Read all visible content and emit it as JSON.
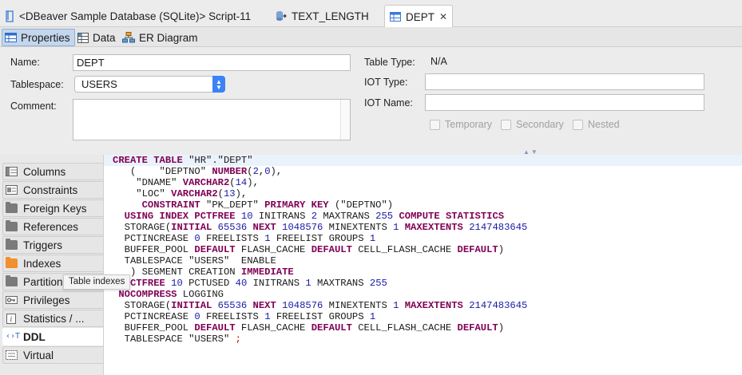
{
  "editor_tabs": [
    {
      "label": "<DBeaver Sample Database (SQLite)> Script-11",
      "icon": "sql-script-icon"
    },
    {
      "label": "TEXT_LENGTH",
      "icon": "procedure-icon"
    },
    {
      "label": "DEPT",
      "icon": "table-icon",
      "close": "✕"
    }
  ],
  "sub_tabs": [
    {
      "label": "Properties",
      "icon": "table-properties-icon"
    },
    {
      "label": "Data",
      "icon": "data-grid-icon"
    },
    {
      "label": "ER Diagram",
      "icon": "er-diagram-icon"
    }
  ],
  "properties": {
    "name_label": "Name:",
    "name_value": "DEPT",
    "tablespace_label": "Tablespace:",
    "tablespace_value": "USERS",
    "comment_label": "Comment:",
    "comment_value": "",
    "table_type_label": "Table Type:",
    "table_type_value": "N/A",
    "iot_type_label": "IOT Type:",
    "iot_type_value": "",
    "iot_name_label": "IOT Name:",
    "iot_name_value": "",
    "checkboxes": [
      "Temporary",
      "Secondary",
      "Nested"
    ]
  },
  "left_tabs": [
    {
      "label": "Columns",
      "icon": "columns-icon"
    },
    {
      "label": "Constraints",
      "icon": "constraints-icon"
    },
    {
      "label": "Foreign Keys",
      "icon": "folder-icon"
    },
    {
      "label": "References",
      "icon": "folder-icon"
    },
    {
      "label": "Triggers",
      "icon": "folder-icon"
    },
    {
      "label": "Indexes",
      "icon": "folder-orange-icon"
    },
    {
      "label": "Partitions",
      "icon": "folder-icon"
    },
    {
      "label": "Privileges",
      "icon": "key-icon"
    },
    {
      "label": "Statistics / ...",
      "icon": "info-icon"
    },
    {
      "label": "DDL",
      "icon": "ddl-icon",
      "active": true
    },
    {
      "label": "Virtual",
      "icon": "virtual-icon"
    }
  ],
  "tooltip": "Table indexes",
  "ddl_lines": [
    [
      [
        "kw",
        "CREATE TABLE "
      ],
      [
        "st",
        "\"HR\".\"DEPT\""
      ]
    ],
    [
      [
        "st",
        "   (    \"DEPTNO\" "
      ],
      [
        "kw",
        "NUMBER"
      ],
      [
        "st",
        "("
      ],
      [
        "nm",
        "2"
      ],
      [
        "st",
        ","
      ],
      [
        "nm",
        "0"
      ],
      [
        "st",
        "),"
      ]
    ],
    [
      [
        "st",
        "    \"DNAME\" "
      ],
      [
        "kw",
        "VARCHAR2"
      ],
      [
        "st",
        "("
      ],
      [
        "nm",
        "14"
      ],
      [
        "st",
        "),"
      ]
    ],
    [
      [
        "st",
        "    \"LOC\" "
      ],
      [
        "kw",
        "VARCHAR2"
      ],
      [
        "st",
        "("
      ],
      [
        "nm",
        "13"
      ],
      [
        "st",
        "),"
      ]
    ],
    [
      [
        "st",
        "     "
      ],
      [
        "kw",
        "CONSTRAINT "
      ],
      [
        "st",
        "\"PK_DEPT\" "
      ],
      [
        "kw",
        "PRIMARY KEY "
      ],
      [
        "st",
        "(\"DEPTNO\")"
      ]
    ],
    [
      [
        "st",
        "  "
      ],
      [
        "kw",
        "USING INDEX PCTFREE "
      ],
      [
        "nm",
        "10"
      ],
      [
        "st",
        " INITRANS "
      ],
      [
        "nm",
        "2"
      ],
      [
        "st",
        " MAXTRANS "
      ],
      [
        "nm",
        "255"
      ],
      [
        "kw",
        " COMPUTE STATISTICS"
      ]
    ],
    [
      [
        "st",
        "  STORAGE("
      ],
      [
        "kw",
        "INITIAL "
      ],
      [
        "nm",
        "65536"
      ],
      [
        "kw",
        " NEXT "
      ],
      [
        "nm",
        "1048576"
      ],
      [
        "st",
        " MINEXTENTS "
      ],
      [
        "nm",
        "1"
      ],
      [
        "kw",
        " MAXEXTENTS "
      ],
      [
        "nm",
        "2147483645"
      ]
    ],
    [
      [
        "st",
        "  PCTINCREASE "
      ],
      [
        "nm",
        "0"
      ],
      [
        "st",
        " FREELISTS "
      ],
      [
        "nm",
        "1"
      ],
      [
        "st",
        " FREELIST GROUPS "
      ],
      [
        "nm",
        "1"
      ]
    ],
    [
      [
        "st",
        "  BUFFER_POOL "
      ],
      [
        "kw",
        "DEFAULT"
      ],
      [
        "st",
        " FLASH_CACHE "
      ],
      [
        "kw",
        "DEFAULT"
      ],
      [
        "st",
        " CELL_FLASH_CACHE "
      ],
      [
        "kw",
        "DEFAULT"
      ],
      [
        "st",
        ")"
      ]
    ],
    [
      [
        "st",
        "  TABLESPACE \"USERS\"  ENABLE"
      ]
    ],
    [
      [
        "st",
        "   ) SEGMENT CREATION "
      ],
      [
        "kw",
        "IMMEDIATE"
      ]
    ],
    [
      [
        "st",
        "  "
      ],
      [
        "kw",
        "PCTFREE "
      ],
      [
        "nm",
        "10"
      ],
      [
        "st",
        " PCTUSED "
      ],
      [
        "nm",
        "40"
      ],
      [
        "st",
        " INITRANS "
      ],
      [
        "nm",
        "1"
      ],
      [
        "st",
        " MAXTRANS "
      ],
      [
        "nm",
        "255"
      ]
    ],
    [
      [
        "st",
        " "
      ],
      [
        "kw",
        "NOCOMPRESS"
      ],
      [
        "st",
        " LOGGING"
      ]
    ],
    [
      [
        "st",
        "  STORAGE("
      ],
      [
        "kw",
        "INITIAL "
      ],
      [
        "nm",
        "65536"
      ],
      [
        "kw",
        " NEXT "
      ],
      [
        "nm",
        "1048576"
      ],
      [
        "st",
        " MINEXTENTS "
      ],
      [
        "nm",
        "1"
      ],
      [
        "kw",
        " MAXEXTENTS "
      ],
      [
        "nm",
        "2147483645"
      ]
    ],
    [
      [
        "st",
        "  PCTINCREASE "
      ],
      [
        "nm",
        "0"
      ],
      [
        "st",
        " FREELISTS "
      ],
      [
        "nm",
        "1"
      ],
      [
        "st",
        " FREELIST GROUPS "
      ],
      [
        "nm",
        "1"
      ]
    ],
    [
      [
        "st",
        "  BUFFER_POOL "
      ],
      [
        "kw",
        "DEFAULT"
      ],
      [
        "st",
        " FLASH_CACHE "
      ],
      [
        "kw",
        "DEFAULT"
      ],
      [
        "st",
        " CELL_FLASH_CACHE "
      ],
      [
        "kw",
        "DEFAULT"
      ],
      [
        "st",
        ")"
      ]
    ],
    [
      [
        "st",
        "  TABLESPACE \"USERS\" "
      ],
      [
        "dl",
        ";"
      ]
    ]
  ]
}
